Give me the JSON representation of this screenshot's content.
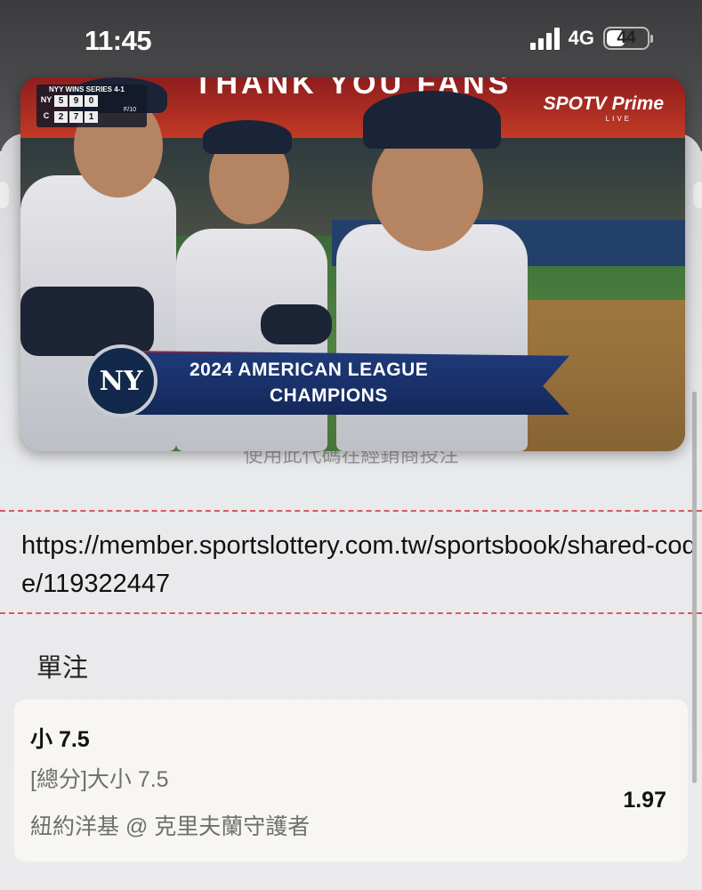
{
  "status_bar": {
    "time": "11:45",
    "network": "4G",
    "battery": "44"
  },
  "video": {
    "banner_text": "THANK YOU FANS",
    "scorebug": {
      "title": "NYY WINS SERIES 4-1",
      "teams": [
        {
          "abbr": "NY",
          "runs": "5",
          "hits": "9",
          "errors": "0"
        },
        {
          "abbr": "C",
          "runs": "2",
          "hits": "7",
          "errors": "1"
        }
      ],
      "inning": "F/10"
    },
    "network_logo": "SPOTV Prime",
    "network_sub": "LIVE",
    "team_logo": "NY",
    "champion_line1": "2024 AMERICAN LEAGUE",
    "champion_line2": "CHAMPIONS"
  },
  "page": {
    "faded_text": "使用此代碼在經銷商投注",
    "share_link": "https://member.sportslottery.com.tw/sportsbook/shared-code/119322447",
    "section_title": "單注",
    "bet": {
      "selection": "小 7.5",
      "market": "[總分]大小 7.5",
      "match": "紐約洋基 @ 克里夫蘭守護者",
      "odds": "1.97"
    }
  },
  "colors": {
    "divider": "#d95a5a",
    "card_bg": "#f8f6f3",
    "ribbon": "#1f3a7a"
  }
}
